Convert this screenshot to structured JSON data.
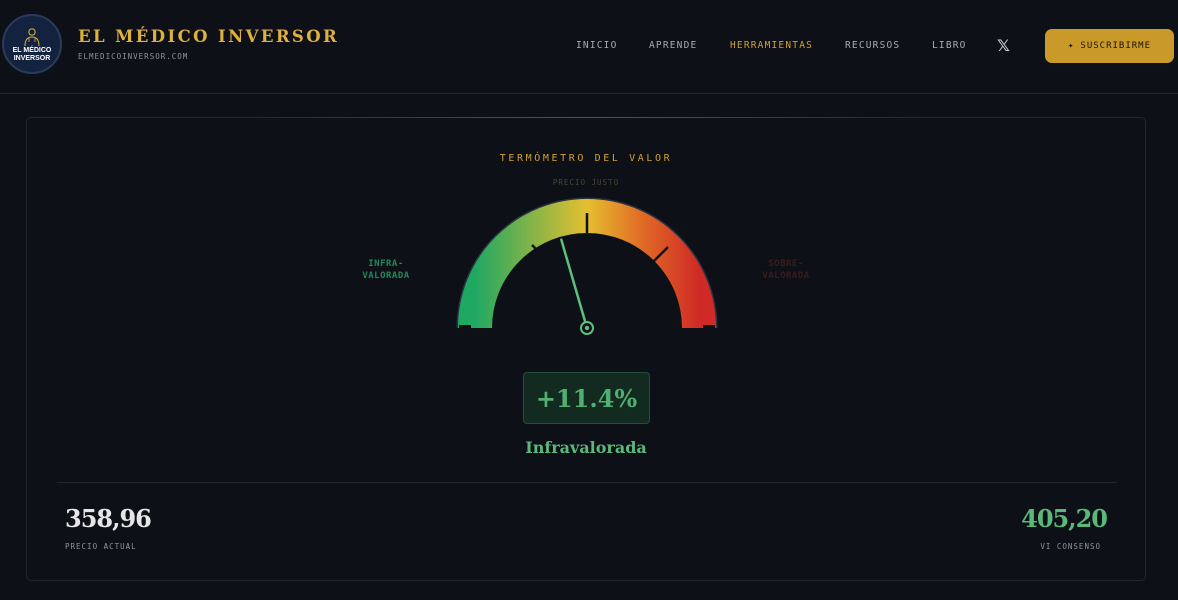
{
  "brand": {
    "logo_text_line1": "EL MÉDICO",
    "logo_text_line2": "INVERSOR",
    "title": "EL MÉDICO INVERSOR",
    "domain": "ELMEDICOINVERSOR.COM"
  },
  "nav": {
    "items": [
      {
        "label": "INICIO",
        "active": false
      },
      {
        "label": "APRENDE",
        "active": false
      },
      {
        "label": "HERRAMIENTAS",
        "active": true
      },
      {
        "label": "RECURSOS",
        "active": false
      },
      {
        "label": "LIBRO",
        "active": false
      }
    ],
    "social_icon": "x-logo-icon",
    "social_glyph": "𝕏",
    "subscribe_label": "SUSCRIBIRME",
    "subscribe_icon": "sparkle-icon"
  },
  "gauge": {
    "title": "TERMÓMETRO DEL VALOR",
    "center_label": "PRECIO JUSTO",
    "left_label_line1": "INFRA-",
    "left_label_line2": "VALORADA",
    "right_label_line1": "SOBRE-",
    "right_label_line2": "VALORADA",
    "needle_fraction": 0.41,
    "percentage": "+11.4%",
    "verdict": "Infravalorada",
    "colors": {
      "green": "#1fa862",
      "yellow": "#e5bf30",
      "orange": "#e06a25",
      "red": "#cf2a26",
      "needle": "#5cc07d"
    }
  },
  "values": {
    "current_price": "358,96",
    "current_price_label": "PRECIO ACTUAL",
    "intrinsic_value": "405,20",
    "intrinsic_value_label": "VI CONSENSO"
  },
  "theme": {
    "background": "#0d1117",
    "accent_gold": "#d29f33",
    "positive_green": "#5cb87a"
  }
}
